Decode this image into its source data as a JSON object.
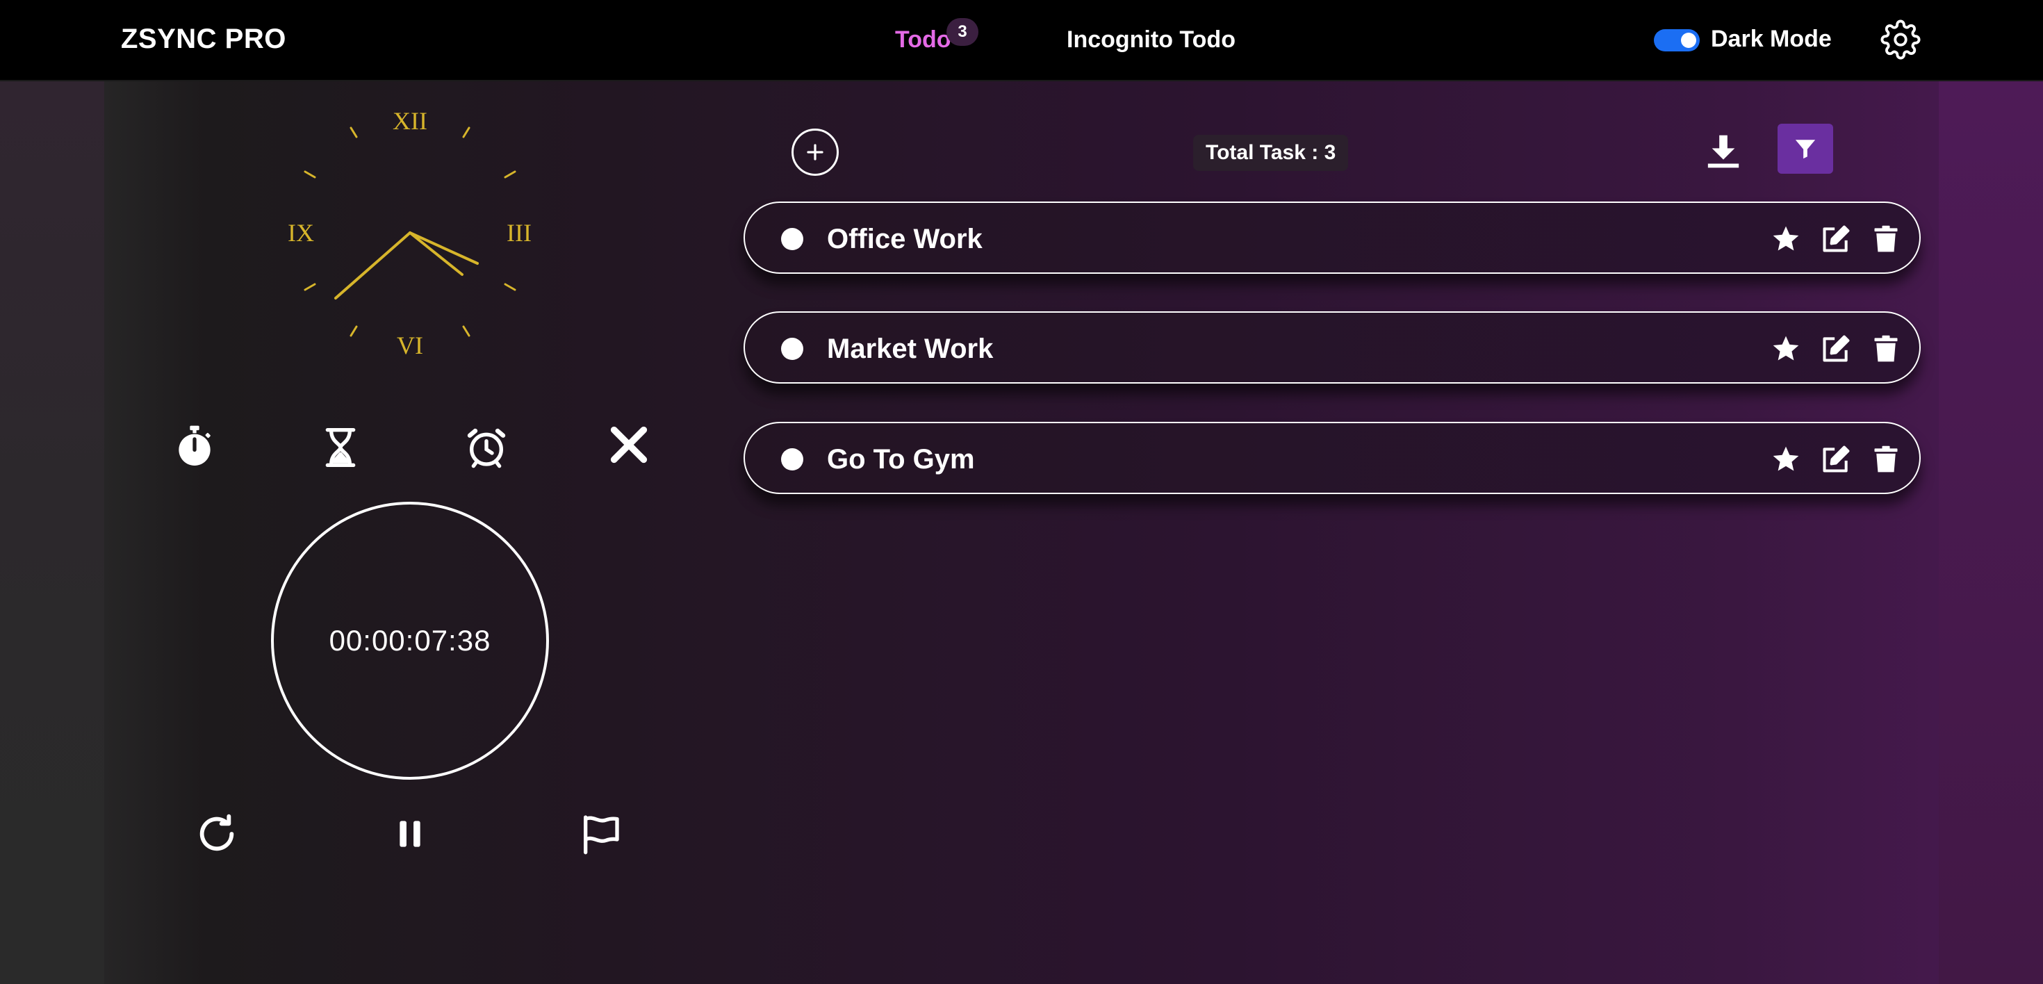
{
  "header": {
    "brand": "ZSYNC PRO",
    "tabs": [
      {
        "label": "Todo",
        "badge": "3",
        "active": true
      },
      {
        "label": "Incognito Todo",
        "active": false
      }
    ],
    "dark_mode": {
      "label": "Dark Mode",
      "enabled": true
    }
  },
  "clock": {
    "numerals": [
      "XII",
      "III",
      "VI",
      "IX"
    ],
    "color": "#d7b52b"
  },
  "tools": [
    "stopwatch-icon",
    "hourglass-icon",
    "alarm-clock-icon",
    "close-icon"
  ],
  "stopwatch": {
    "time": "00:00:07:38",
    "controls": [
      "reset-icon",
      "pause-icon",
      "flag-icon"
    ]
  },
  "tasks_toolbar": {
    "total_label": "Total Task : 3"
  },
  "tasks": [
    {
      "title": "Office Work"
    },
    {
      "title": "Market Work"
    },
    {
      "title": "Go To Gym"
    }
  ],
  "colors": {
    "accent": "#e46ae6",
    "filter_button": "#6a2fa0",
    "toggle": "#1b6ef3"
  }
}
